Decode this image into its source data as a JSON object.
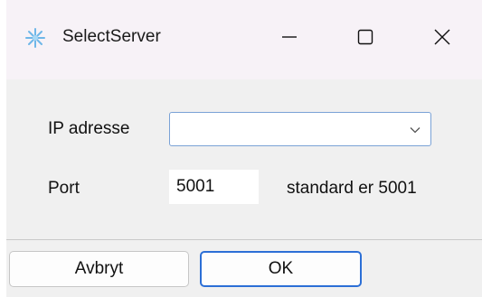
{
  "window": {
    "title": "SelectServer",
    "controls": {
      "minimize": "minimize",
      "maximize": "maximize",
      "close": "close"
    }
  },
  "icons": {
    "app": "snowflake-icon",
    "minimize": "minimize-icon",
    "maximize": "maximize-icon",
    "close": "close-icon",
    "dropdown": "chevron-down-icon"
  },
  "form": {
    "ip_label": "IP adresse",
    "ip_value": "",
    "port_label": "Port",
    "port_value": "5001",
    "port_hint": "standard er 5001"
  },
  "buttons": {
    "cancel": "Avbryt",
    "ok": "OK"
  },
  "colors": {
    "titlebar_bg": "#f7f2f7",
    "dialog_bg": "#f0f0f0",
    "focus_accent": "#2c6fd6",
    "combo_border": "#7aa2d6"
  }
}
